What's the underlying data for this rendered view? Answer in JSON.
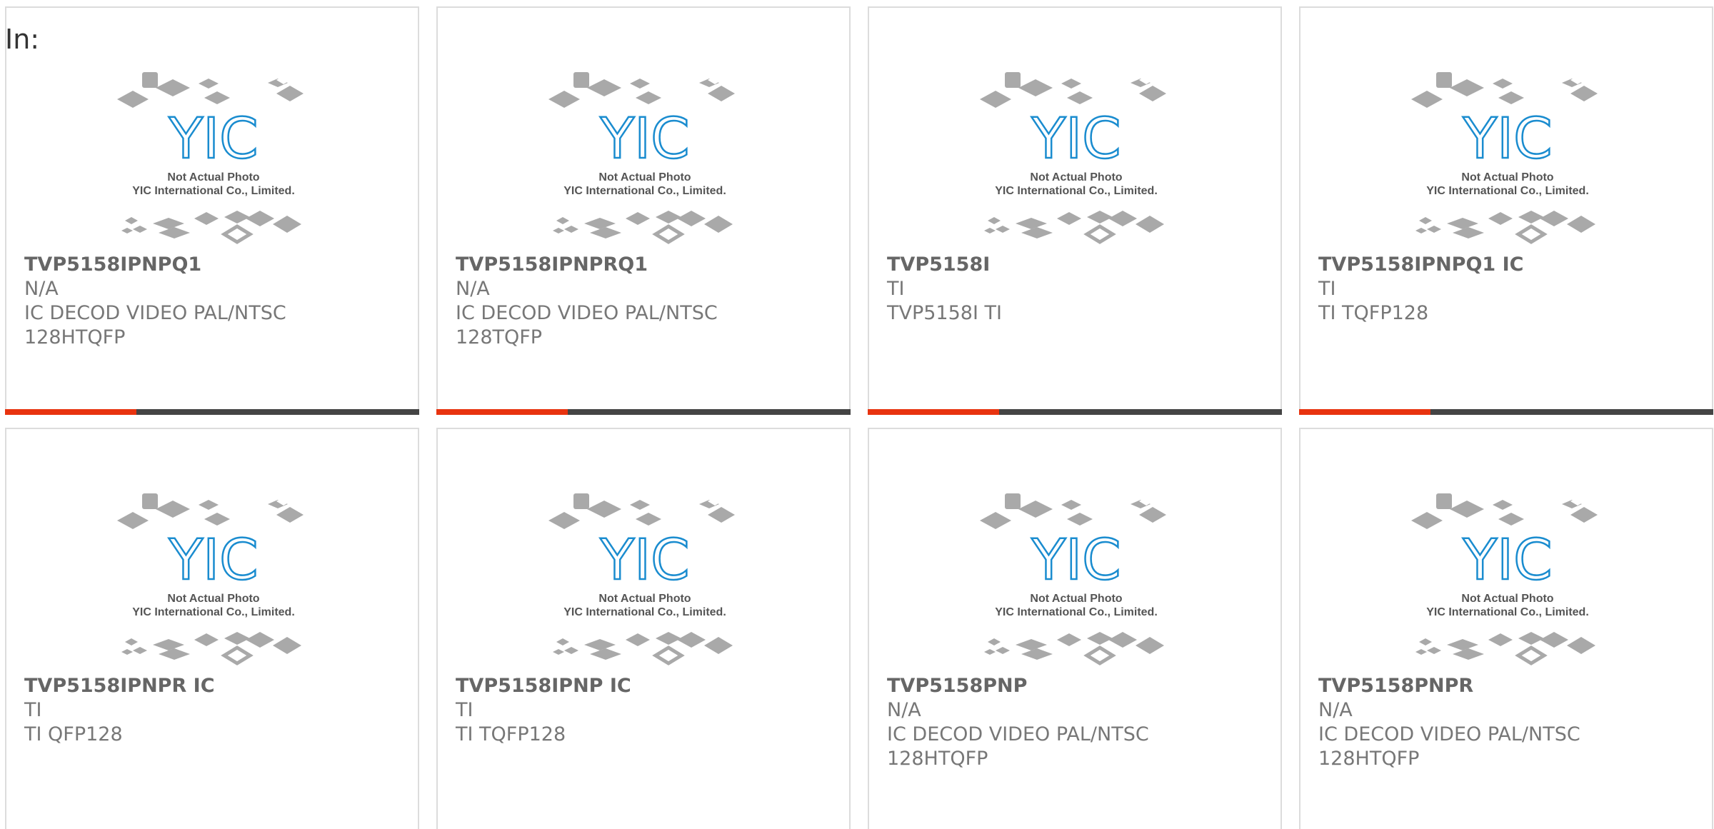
{
  "heading": "In:",
  "photo": {
    "logo_text": "YIC",
    "caption_line1": "Not Actual Photo",
    "caption_line2": "YIC International Co., Limited.",
    "logo_color": "#1a8ccf",
    "chip_color": "#a9a9a9"
  },
  "bar_colors": {
    "accent": "#e8330f",
    "rest": "#444444"
  },
  "products": [
    {
      "part": "TVP5158IPNPQ1",
      "manufacturer": "N/A",
      "description": "IC DECOD VIDEO PAL/NTSC",
      "package": "128HTQFP"
    },
    {
      "part": "TVP5158IPNPRQ1",
      "manufacturer": "N/A",
      "description": "IC DECOD VIDEO PAL/NTSC",
      "package": "128TQFP"
    },
    {
      "part": "TVP5158I",
      "manufacturer": "TI",
      "description": "TVP5158I TI",
      "package": ""
    },
    {
      "part": "TVP5158IPNPQ1 IC",
      "manufacturer": "TI",
      "description": "TI TQFP128",
      "package": ""
    },
    {
      "part": "TVP5158IPNPR IC",
      "manufacturer": "TI",
      "description": "TI QFP128",
      "package": ""
    },
    {
      "part": "TVP5158IPNP IC",
      "manufacturer": "TI",
      "description": "TI TQFP128",
      "package": ""
    },
    {
      "part": "TVP5158PNP",
      "manufacturer": "N/A",
      "description": "IC DECOD VIDEO PAL/NTSC",
      "package": "128HTQFP"
    },
    {
      "part": "TVP5158PNPR",
      "manufacturer": "N/A",
      "description": "IC DECOD VIDEO PAL/NTSC",
      "package": "128HTQFP"
    }
  ]
}
